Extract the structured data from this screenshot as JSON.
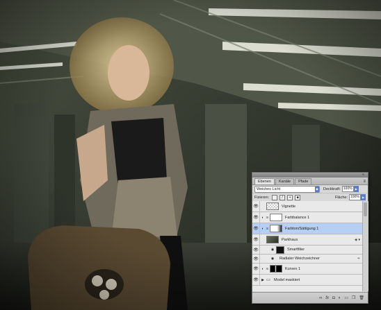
{
  "panel": {
    "tabs": [
      {
        "label": "Ebenen"
      },
      {
        "label": "Kanäle"
      },
      {
        "label": "Pfade"
      }
    ],
    "blend_mode": "Weiches Licht",
    "opacity_label": "Deckkraft:",
    "opacity_value": "100%",
    "fill_label": "Fläche:",
    "fill_value": "100%",
    "lock_label": "Fixieren:",
    "layers": [
      {
        "name": "Vignette"
      },
      {
        "name": "Farbbalance 1"
      },
      {
        "name": "Farbton/Sättigung 1"
      },
      {
        "name": "Parkhaus"
      },
      {
        "name": "Smartfilter"
      },
      {
        "name": "Radialer Weichzeichner"
      },
      {
        "name": "Kurven 1"
      },
      {
        "name": "Model maskiert"
      }
    ],
    "footer_icons": [
      "link-icon",
      "fx-icon",
      "mask-icon",
      "adjustment-icon",
      "group-icon",
      "new-layer-icon",
      "trash-icon"
    ]
  }
}
